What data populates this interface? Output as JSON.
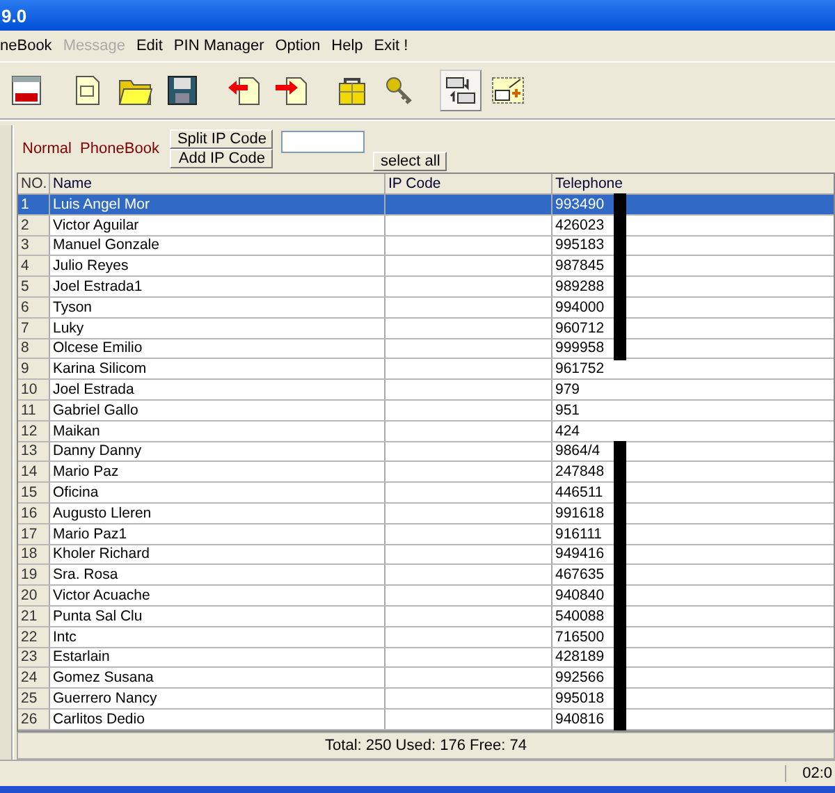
{
  "window": {
    "title": "9.0"
  },
  "menu": [
    {
      "label": "neBook",
      "disabled": false
    },
    {
      "label": "Message",
      "disabled": true
    },
    {
      "label": "Edit",
      "disabled": false
    },
    {
      "label": "PIN Manager",
      "disabled": false
    },
    {
      "label": "Option",
      "disabled": false
    },
    {
      "label": "Help",
      "disabled": false
    },
    {
      "label": "Exit !",
      "disabled": false
    }
  ],
  "toolbar": [
    {
      "kind": "sms",
      "pressed": false
    },
    {
      "kind": "document",
      "pressed": false
    },
    {
      "kind": "folder",
      "pressed": false
    },
    {
      "kind": "disk",
      "pressed": false
    },
    {
      "kind": "import",
      "pressed": false
    },
    {
      "kind": "export",
      "pressed": false
    },
    {
      "kind": "box",
      "pressed": false
    },
    {
      "kind": "key",
      "pressed": false
    },
    {
      "kind": "swap",
      "pressed": true
    },
    {
      "kind": "card",
      "pressed": false
    }
  ],
  "panel": {
    "title": "Normal  PhoneBook",
    "buttons": [
      "Split IP Code",
      "Add IP Code"
    ],
    "select_all": "select all"
  },
  "table": {
    "columns": [
      "NO.",
      "Name",
      "IP Code",
      "Telephone"
    ],
    "rows": [
      {
        "no": "1",
        "name": "Luis Angel Mor",
        "telephone": "993490",
        "redacted": true,
        "selected": true
      },
      {
        "no": "2",
        "name": "Victor Aguilar",
        "telephone": "426023",
        "redacted": true,
        "selected": false
      },
      {
        "no": "3",
        "name": "Manuel Gonzale",
        "telephone": "995183",
        "redacted": true,
        "selected": false
      },
      {
        "no": "4",
        "name": "Julio Reyes",
        "telephone": "987845",
        "redacted": true,
        "selected": false
      },
      {
        "no": "5",
        "name": "Joel Estrada1",
        "telephone": "989288",
        "redacted": true,
        "selected": false
      },
      {
        "no": "6",
        "name": "Tyson",
        "telephone": "994000",
        "redacted": true,
        "selected": false
      },
      {
        "no": "7",
        "name": "Luky",
        "telephone": "960712",
        "redacted": true,
        "selected": false
      },
      {
        "no": "8",
        "name": "Olcese Emilio",
        "telephone": "999958",
        "redacted": true,
        "selected": false
      },
      {
        "no": "9",
        "name": "Karina Silicom",
        "telephone": "961752",
        "redacted": false,
        "selected": false
      },
      {
        "no": "10",
        "name": "Joel Estrada",
        "telephone": "979",
        "redacted": false,
        "selected": false
      },
      {
        "no": "11",
        "name": "Gabriel Gallo",
        "telephone": "951",
        "redacted": false,
        "selected": false
      },
      {
        "no": "12",
        "name": "Maikan",
        "telephone": "424",
        "redacted": false,
        "selected": false
      },
      {
        "no": "13",
        "name": "Danny Danny",
        "telephone": "9864/4",
        "redacted": true,
        "selected": false
      },
      {
        "no": "14",
        "name": "Mario Paz",
        "telephone": "247848",
        "redacted": true,
        "selected": false
      },
      {
        "no": "15",
        "name": "Oficina",
        "telephone": "446511",
        "redacted": true,
        "selected": false
      },
      {
        "no": "16",
        "name": "Augusto Lleren",
        "telephone": "991618",
        "redacted": true,
        "selected": false
      },
      {
        "no": "17",
        "name": "Mario Paz1",
        "telephone": "916111",
        "redacted": true,
        "selected": false
      },
      {
        "no": "18",
        "name": "Kholer Richard",
        "telephone": "949416",
        "redacted": true,
        "selected": false
      },
      {
        "no": "19",
        "name": "Sra. Rosa",
        "telephone": "467635",
        "redacted": true,
        "selected": false
      },
      {
        "no": "20",
        "name": "Victor Acuache",
        "telephone": "940840",
        "redacted": true,
        "selected": false
      },
      {
        "no": "21",
        "name": "Punta Sal  Clu",
        "telephone": "540088",
        "redacted": true,
        "selected": false
      },
      {
        "no": "22",
        "name": "Intc",
        "telephone": "716500",
        "redacted": true,
        "selected": false
      },
      {
        "no": "23",
        "name": "Estarlain",
        "telephone": "428189",
        "redacted": true,
        "selected": false
      },
      {
        "no": "24",
        "name": "Gomez Susana",
        "telephone": "992566",
        "redacted": true,
        "selected": false
      },
      {
        "no": "25",
        "name": "Guerrero Nancy",
        "telephone": "995018",
        "redacted": true,
        "selected": false
      },
      {
        "no": "26",
        "name": "Carlitos Dedio",
        "telephone": "940816",
        "redacted": true,
        "selected": false
      }
    ]
  },
  "summary": "Total: 250  Used: 176  Free: 74",
  "status_bar": {
    "time": "02:0"
  }
}
